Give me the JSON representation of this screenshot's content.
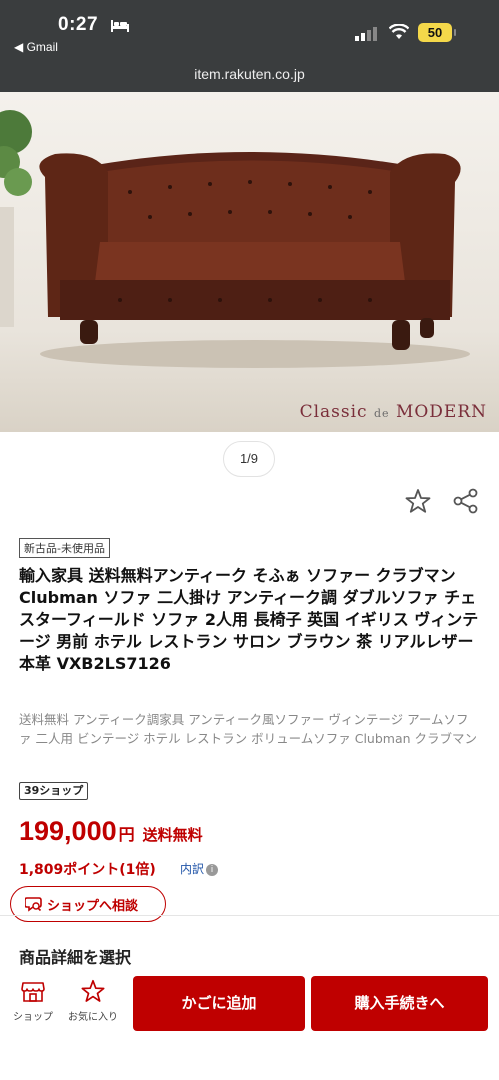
{
  "status_bar": {
    "time": "0:27",
    "back_app": "◀ Gmail",
    "battery": "50"
  },
  "browser": {
    "url": "item.rakuten.co.jp"
  },
  "gallery": {
    "watermark_main": "Classic",
    "watermark_de": "de",
    "watermark_end": "MODERN",
    "pager": "1/9"
  },
  "product": {
    "condition": "新古品-未使用品",
    "title": "輸入家具 送料無料アンティーク そふぁ ソファー クラブマン Clubman ソファ 二人掛け アンティーク調 ダブルソファ チェスターフィールド ソファ 2人用 長椅子 英国 イギリス ヴィンテージ 男前 ホテル レストラン サロン ブラウン 茶 リアルレザー 本革 VXB2LS7126",
    "subtitle": "送料無料 アンティーク調家具 アンティーク風ソファー ヴィンテージ アームソファ 二人用 ビンテージ ホテル レストラン ボリュームソファ Clubman クラブマン",
    "shop_badge": "39ショップ",
    "price": "199,000",
    "price_unit": "円",
    "shipping": "送料無料",
    "points": "1,809ポイント(1倍)",
    "breakdown": "内訳",
    "consult_label": "ショップへ相談",
    "select_detail": "商品詳細を選択"
  },
  "bottom_bar": {
    "shop_label": "ショップ",
    "fav_label": "お気に入り",
    "cart_label": "かごに追加",
    "buy_label": "購入手続きへ"
  },
  "colors": {
    "accent": "#bf0000",
    "topbar": "#3a3d3e",
    "battery": "#f4d84a"
  },
  "icons": [
    "bed-icon",
    "signal-icon",
    "wifi-icon",
    "star-icon",
    "share-icon",
    "chat-icon",
    "info-icon",
    "shop-icon",
    "favorite-star-icon"
  ]
}
